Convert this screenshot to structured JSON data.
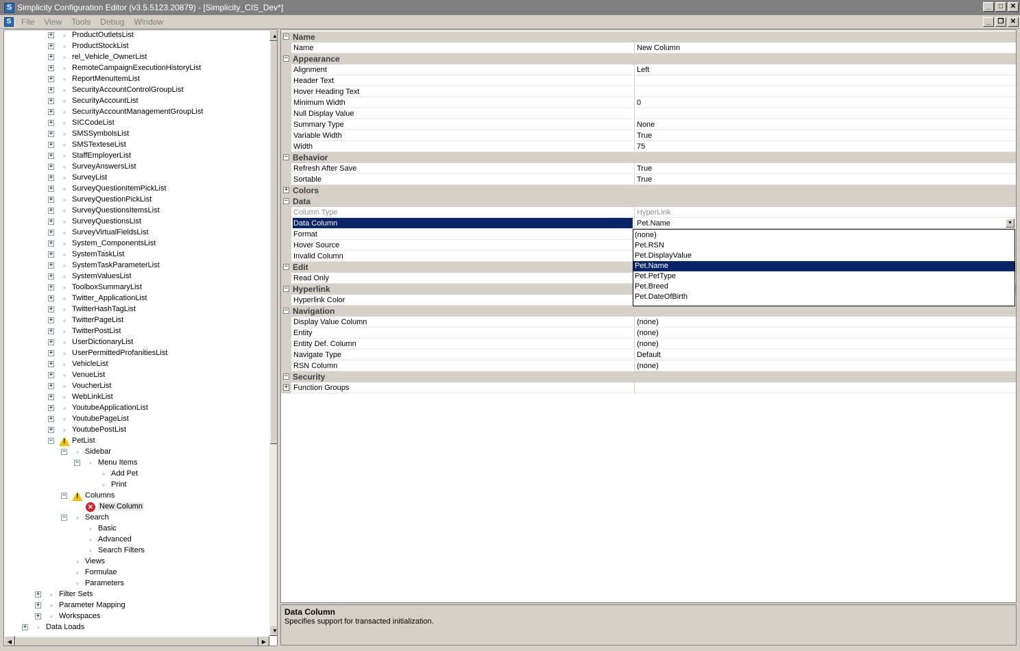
{
  "window": {
    "title": "Simplicity Configuration Editor (v3.5.5123.20879) - [Simplicity_CIS_Dev*]",
    "logo": "S",
    "controls": [
      "minimize-icon",
      "maximize-icon",
      "close-icon"
    ]
  },
  "menu": {
    "items": [
      "File",
      "View",
      "Tools",
      "Debug",
      "Window"
    ]
  },
  "tree": {
    "items": [
      {
        "label": "ProductOutletsList",
        "level": 3,
        "exp": "+"
      },
      {
        "label": "ProductStockList",
        "level": 3,
        "exp": "+"
      },
      {
        "label": "rel_Vehicle_OwnerList",
        "level": 3,
        "exp": "+"
      },
      {
        "label": "RemoteCampaignExecutionHistoryList",
        "level": 3,
        "exp": "+"
      },
      {
        "label": "ReportMenuItemList",
        "level": 3,
        "exp": "+"
      },
      {
        "label": "SecurityAccountControlGroupList",
        "level": 3,
        "exp": "+"
      },
      {
        "label": "SecurityAccountList",
        "level": 3,
        "exp": "+"
      },
      {
        "label": "SecurityAccountManagementGroupList",
        "level": 3,
        "exp": "+"
      },
      {
        "label": "SICCodeList",
        "level": 3,
        "exp": "+"
      },
      {
        "label": "SMSSymbolsList",
        "level": 3,
        "exp": "+"
      },
      {
        "label": "SMSTexteseList",
        "level": 3,
        "exp": "+"
      },
      {
        "label": "StaffEmployerList",
        "level": 3,
        "exp": "+"
      },
      {
        "label": "SurveyAnswersList",
        "level": 3,
        "exp": "+"
      },
      {
        "label": "SurveyList",
        "level": 3,
        "exp": "+"
      },
      {
        "label": "SurveyQuestionItemPickList",
        "level": 3,
        "exp": "+"
      },
      {
        "label": "SurveyQuestionPickList",
        "level": 3,
        "exp": "+"
      },
      {
        "label": "SurveyQuestionsItemsList",
        "level": 3,
        "exp": "+"
      },
      {
        "label": "SurveyQuestionsList",
        "level": 3,
        "exp": "+"
      },
      {
        "label": "SurveyVirtualFieldsList",
        "level": 3,
        "exp": "+"
      },
      {
        "label": "System_ComponentsList",
        "level": 3,
        "exp": "+"
      },
      {
        "label": "SystemTaskList",
        "level": 3,
        "exp": "+"
      },
      {
        "label": "SystemTaskParameterList",
        "level": 3,
        "exp": "+"
      },
      {
        "label": "SystemValuesList",
        "level": 3,
        "exp": "+"
      },
      {
        "label": "ToolboxSummaryList",
        "level": 3,
        "exp": "+"
      },
      {
        "label": "Twitter_ApplicationList",
        "level": 3,
        "exp": "+"
      },
      {
        "label": "TwitterHashTagList",
        "level": 3,
        "exp": "+"
      },
      {
        "label": "TwitterPageList",
        "level": 3,
        "exp": "+"
      },
      {
        "label": "TwitterPostList",
        "level": 3,
        "exp": "+"
      },
      {
        "label": "UserDictionaryList",
        "level": 3,
        "exp": "+"
      },
      {
        "label": "UserPermittedProfanitiesList",
        "level": 3,
        "exp": "+"
      },
      {
        "label": "VehicleList",
        "level": 3,
        "exp": "+"
      },
      {
        "label": "VenueList",
        "level": 3,
        "exp": "+"
      },
      {
        "label": "VoucherList",
        "level": 3,
        "exp": "+"
      },
      {
        "label": "WebLinkList",
        "level": 3,
        "exp": "+"
      },
      {
        "label": "YoutubeApplicationList",
        "level": 3,
        "exp": "+"
      },
      {
        "label": "YoutubePageList",
        "level": 3,
        "exp": "+"
      },
      {
        "label": "YoutubePostList",
        "level": 3,
        "exp": "+"
      },
      {
        "label": "PetList",
        "level": 3,
        "exp": "−",
        "icon": "warning"
      },
      {
        "label": "Sidebar",
        "level": 4,
        "exp": "−"
      },
      {
        "label": "Menu Items",
        "level": 5,
        "exp": "−"
      },
      {
        "label": "Add Pet",
        "level": 6,
        "exp": ""
      },
      {
        "label": "Print",
        "level": 6,
        "exp": ""
      },
      {
        "label": "Columns",
        "level": 4,
        "exp": "−",
        "icon": "warning"
      },
      {
        "label": "New Column",
        "level": 5,
        "exp": "",
        "icon": "error",
        "selected": true
      },
      {
        "label": "Search",
        "level": 4,
        "exp": "−"
      },
      {
        "label": "Basic",
        "level": 5,
        "exp": ""
      },
      {
        "label": "Advanced",
        "level": 5,
        "exp": ""
      },
      {
        "label": "Search Filters",
        "level": 5,
        "exp": ""
      },
      {
        "label": "Views",
        "level": 4,
        "exp": ""
      },
      {
        "label": "Formulae",
        "level": 4,
        "exp": ""
      },
      {
        "label": "Parameters",
        "level": 4,
        "exp": ""
      },
      {
        "label": "Filter Sets",
        "level": 2,
        "exp": "+"
      },
      {
        "label": "Parameter Mapping",
        "level": 2,
        "exp": "+"
      },
      {
        "label": "Workspaces",
        "level": 2,
        "exp": "+"
      },
      {
        "label": "Data Loads",
        "level": 1,
        "exp": "+"
      }
    ]
  },
  "properties": {
    "rows": [
      {
        "type": "cat",
        "label": "Name",
        "exp": "−"
      },
      {
        "type": "prop",
        "name": "Name",
        "value": "New Column"
      },
      {
        "type": "cat",
        "label": "Appearance",
        "exp": "−"
      },
      {
        "type": "prop",
        "name": "Alignment",
        "value": "Left"
      },
      {
        "type": "prop",
        "name": "Header Text",
        "value": ""
      },
      {
        "type": "prop",
        "name": "Hover Heading Text",
        "value": ""
      },
      {
        "type": "prop",
        "name": "Minimum Width",
        "value": "0"
      },
      {
        "type": "prop",
        "name": "Null Display Value",
        "value": ""
      },
      {
        "type": "prop",
        "name": "Summary Type",
        "value": "None"
      },
      {
        "type": "prop",
        "name": "Variable Width",
        "value": "True"
      },
      {
        "type": "prop",
        "name": "Width",
        "value": "75"
      },
      {
        "type": "cat",
        "label": "Behavior",
        "exp": "−"
      },
      {
        "type": "prop",
        "name": "Refresh After Save",
        "value": "True"
      },
      {
        "type": "prop",
        "name": "Sortable",
        "value": "True"
      },
      {
        "type": "cat",
        "label": "Colors",
        "exp": "+"
      },
      {
        "type": "cat",
        "label": "Data",
        "exp": "−"
      },
      {
        "type": "prop",
        "name": "Column Type",
        "value": "HyperLink",
        "disabled": true
      },
      {
        "type": "prop",
        "name": "Data Column",
        "value": "Pet.Name",
        "selected": true,
        "dropdown": true
      },
      {
        "type": "prop",
        "name": "Format",
        "value": ""
      },
      {
        "type": "prop",
        "name": "Hover Source",
        "value": ""
      },
      {
        "type": "prop",
        "name": "Invalid Column",
        "value": ""
      },
      {
        "type": "cat",
        "label": "Edit",
        "exp": "−"
      },
      {
        "type": "prop",
        "name": "Read Only",
        "value": ""
      },
      {
        "type": "cat",
        "label": "Hyperlink",
        "exp": "−"
      },
      {
        "type": "prop",
        "name": "Hyperlink Color",
        "value": ""
      },
      {
        "type": "cat",
        "label": "Navigation",
        "exp": "−"
      },
      {
        "type": "prop",
        "name": "Display Value Column",
        "value": "(none)"
      },
      {
        "type": "prop",
        "name": "Entity",
        "value": "(none)"
      },
      {
        "type": "prop",
        "name": "Entity Def. Column",
        "value": "(none)"
      },
      {
        "type": "prop",
        "name": "Navigate Type",
        "value": "Default"
      },
      {
        "type": "prop",
        "name": "RSN Column",
        "value": "(none)"
      },
      {
        "type": "cat",
        "label": "Security",
        "exp": "−"
      },
      {
        "type": "prop",
        "name": "Function Groups",
        "value": "",
        "exp": "+"
      }
    ]
  },
  "dropdown": {
    "options": [
      "(none)",
      "Pet.RSN",
      "Pet.DisplayValue",
      "Pet.Name",
      "Pet.PetType",
      "Pet.Breed",
      "Pet.DateOfBirth"
    ],
    "selected": "Pet.Name"
  },
  "description": {
    "title": "Data Column",
    "text": "Specifies support for transacted initialization."
  },
  "colors": {
    "selection": "#0a246a",
    "warning": "#f2c200",
    "error": "#d8202a"
  }
}
